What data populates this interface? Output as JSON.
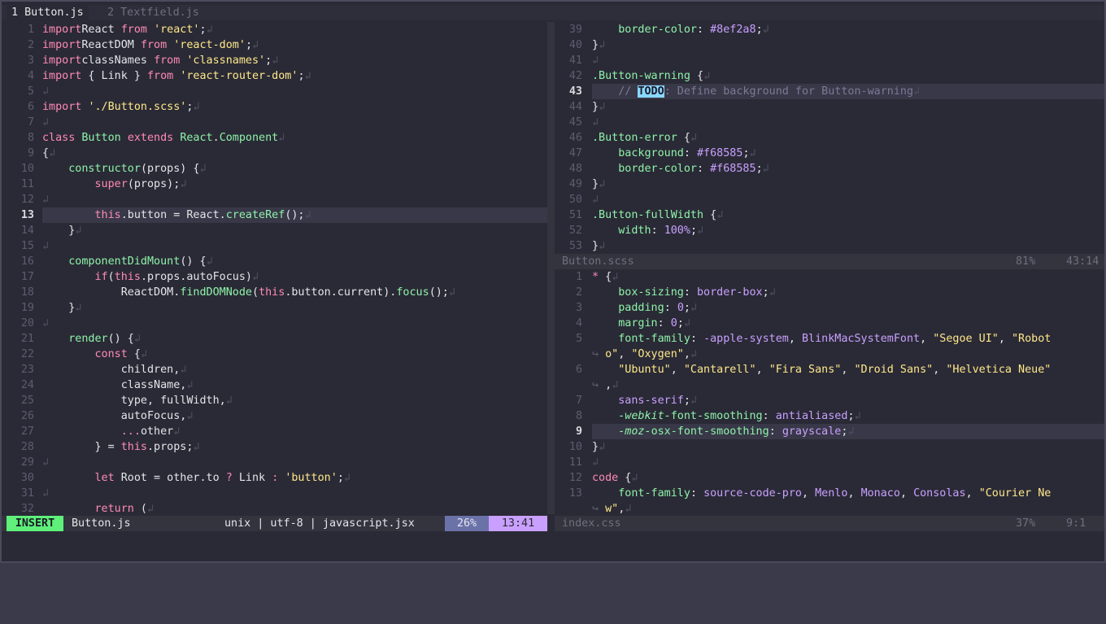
{
  "tabs": [
    {
      "number": "1",
      "label": "Button.js"
    },
    {
      "number": "2",
      "label": "Textfield.js"
    }
  ],
  "eol_glyph": "↲",
  "wrap_glyph": "↪",
  "left_pane": {
    "cursor_line": 13,
    "lines": [
      {
        "n": "1",
        "segs": [
          [
            "kw",
            "import"
          ],
          [
            "",
            "React "
          ],
          [
            "kw",
            "from"
          ],
          [
            "",
            " "
          ],
          [
            "st",
            "'react'"
          ],
          [
            "",
            ";"
          ]
        ]
      },
      {
        "n": "2",
        "segs": [
          [
            "kw",
            "import"
          ],
          [
            "",
            "ReactDOM "
          ],
          [
            "kw",
            "from"
          ],
          [
            "",
            " "
          ],
          [
            "st",
            "'react-dom'"
          ],
          [
            "",
            ";"
          ]
        ]
      },
      {
        "n": "3",
        "segs": [
          [
            "kw",
            "import"
          ],
          [
            "",
            "classNames "
          ],
          [
            "kw",
            "from"
          ],
          [
            "",
            " "
          ],
          [
            "st",
            "'classnames'"
          ],
          [
            "",
            ";"
          ]
        ]
      },
      {
        "n": "4",
        "segs": [
          [
            "kw",
            "import"
          ],
          [
            "",
            " { Link } "
          ],
          [
            "kw",
            "from"
          ],
          [
            "",
            " "
          ],
          [
            "st",
            "'react-router-dom'"
          ],
          [
            "",
            ";"
          ]
        ]
      },
      {
        "n": "5",
        "segs": []
      },
      {
        "n": "6",
        "segs": [
          [
            "kw",
            "import"
          ],
          [
            "",
            " "
          ],
          [
            "st",
            "'./Button.scss'"
          ],
          [
            "",
            ";"
          ]
        ]
      },
      {
        "n": "7",
        "segs": []
      },
      {
        "n": "8",
        "segs": [
          [
            "kw",
            "class"
          ],
          [
            "",
            " "
          ],
          [
            "cl",
            "Button"
          ],
          [
            "",
            " "
          ],
          [
            "kw",
            "extends"
          ],
          [
            "",
            " "
          ],
          [
            "cl",
            "React"
          ],
          [
            "",
            "."
          ],
          [
            "cl",
            "Component"
          ]
        ]
      },
      {
        "n": "9",
        "segs": [
          [
            "",
            "{"
          ]
        ]
      },
      {
        "n": "10",
        "segs": [
          [
            "",
            "    "
          ],
          [
            "fn",
            "constructor"
          ],
          [
            "",
            "(props) {"
          ]
        ]
      },
      {
        "n": "11",
        "segs": [
          [
            "",
            "        "
          ],
          [
            "th",
            "super"
          ],
          [
            "",
            "(props);"
          ]
        ]
      },
      {
        "n": "12",
        "segs": []
      },
      {
        "n": "13",
        "segs": [
          [
            "",
            "        "
          ],
          [
            "th",
            "this"
          ],
          [
            "",
            ".button = React."
          ],
          [
            "fn",
            "createRef"
          ],
          [
            "",
            "();"
          ]
        ]
      },
      {
        "n": "14",
        "segs": [
          [
            "",
            "    }"
          ]
        ]
      },
      {
        "n": "15",
        "segs": []
      },
      {
        "n": "16",
        "segs": [
          [
            "",
            "    "
          ],
          [
            "fn",
            "componentDidMount"
          ],
          [
            "",
            "() {"
          ]
        ]
      },
      {
        "n": "17",
        "segs": [
          [
            "",
            "        "
          ],
          [
            "kw",
            "if"
          ],
          [
            "",
            "("
          ],
          [
            "th",
            "this"
          ],
          [
            "",
            ".props.autoFocus)"
          ]
        ]
      },
      {
        "n": "18",
        "segs": [
          [
            "",
            "            ReactDOM."
          ],
          [
            "fn",
            "findDOMNode"
          ],
          [
            "",
            "("
          ],
          [
            "th",
            "this"
          ],
          [
            "",
            ".button.current)."
          ],
          [
            "fn",
            "focus"
          ],
          [
            "",
            "();"
          ]
        ]
      },
      {
        "n": "19",
        "segs": [
          [
            "",
            "    }"
          ]
        ]
      },
      {
        "n": "20",
        "segs": []
      },
      {
        "n": "21",
        "segs": [
          [
            "",
            "    "
          ],
          [
            "fn",
            "render"
          ],
          [
            "",
            "() {"
          ]
        ]
      },
      {
        "n": "22",
        "segs": [
          [
            "",
            "        "
          ],
          [
            "kw",
            "const"
          ],
          [
            "",
            " {"
          ]
        ]
      },
      {
        "n": "23",
        "segs": [
          [
            "",
            "            children,"
          ]
        ]
      },
      {
        "n": "24",
        "segs": [
          [
            "",
            "            className,"
          ]
        ]
      },
      {
        "n": "25",
        "segs": [
          [
            "",
            "            type, fullWidth,"
          ]
        ]
      },
      {
        "n": "26",
        "segs": [
          [
            "",
            "            autoFocus,"
          ]
        ]
      },
      {
        "n": "27",
        "segs": [
          [
            "",
            "            "
          ],
          [
            "kw",
            "..."
          ],
          [
            "",
            "other"
          ]
        ]
      },
      {
        "n": "28",
        "segs": [
          [
            "",
            "        } = "
          ],
          [
            "th",
            "this"
          ],
          [
            "",
            ".props;"
          ]
        ]
      },
      {
        "n": "29",
        "segs": []
      },
      {
        "n": "30",
        "segs": [
          [
            "",
            "        "
          ],
          [
            "kw",
            "let"
          ],
          [
            "",
            " Root = other.to "
          ],
          [
            "kw",
            "?"
          ],
          [
            "",
            " Link "
          ],
          [
            "kw",
            ":"
          ],
          [
            "",
            " "
          ],
          [
            "st",
            "'button'"
          ],
          [
            "",
            ";"
          ]
        ]
      },
      {
        "n": "31",
        "segs": []
      },
      {
        "n": "32",
        "segs": [
          [
            "",
            "        "
          ],
          [
            "kw",
            "return"
          ],
          [
            "",
            " ("
          ]
        ]
      }
    ]
  },
  "right_top_pane": {
    "cursor_line": 43,
    "lines": [
      {
        "n": "39",
        "segs": [
          [
            "",
            "    "
          ],
          [
            "pr",
            "border-color"
          ],
          [
            "",
            ": "
          ],
          [
            "val",
            "#8ef2a8"
          ],
          [
            "",
            ";"
          ]
        ]
      },
      {
        "n": "40",
        "segs": [
          [
            "",
            "}"
          ]
        ]
      },
      {
        "n": "41",
        "segs": []
      },
      {
        "n": "42",
        "segs": [
          [
            "sel",
            ".Button-warning"
          ],
          [
            "",
            " {"
          ]
        ]
      },
      {
        "n": "43",
        "segs": [
          [
            "",
            "    "
          ],
          [
            "cm",
            "// "
          ],
          [
            "todo",
            "TODO"
          ],
          [
            "cm",
            ": Define background for Button-warning"
          ]
        ]
      },
      {
        "n": "44",
        "segs": [
          [
            "",
            "}"
          ]
        ]
      },
      {
        "n": "45",
        "segs": []
      },
      {
        "n": "46",
        "segs": [
          [
            "sel",
            ".Button-error"
          ],
          [
            "",
            " {"
          ]
        ]
      },
      {
        "n": "47",
        "segs": [
          [
            "",
            "    "
          ],
          [
            "pr",
            "background"
          ],
          [
            "",
            ": "
          ],
          [
            "val",
            "#f68585"
          ],
          [
            "",
            ";"
          ]
        ]
      },
      {
        "n": "48",
        "segs": [
          [
            "",
            "    "
          ],
          [
            "pr",
            "border-color"
          ],
          [
            "",
            ": "
          ],
          [
            "val",
            "#f68585"
          ],
          [
            "",
            ";"
          ]
        ]
      },
      {
        "n": "49",
        "segs": [
          [
            "",
            "}"
          ]
        ]
      },
      {
        "n": "50",
        "segs": []
      },
      {
        "n": "51",
        "segs": [
          [
            "sel",
            ".Button-fullWidth"
          ],
          [
            "",
            " {"
          ]
        ]
      },
      {
        "n": "52",
        "segs": [
          [
            "",
            "    "
          ],
          [
            "pr",
            "width"
          ],
          [
            "",
            ": "
          ],
          [
            "val",
            "100%"
          ],
          [
            "",
            ";"
          ]
        ]
      },
      {
        "n": "53",
        "segs": [
          [
            "",
            "}"
          ]
        ]
      }
    ]
  },
  "right_bottom_pane": {
    "cursor_line": 9,
    "lines": [
      {
        "n": "1",
        "segs": [
          [
            "kw",
            "*"
          ],
          [
            "",
            " {"
          ]
        ]
      },
      {
        "n": "2",
        "segs": [
          [
            "",
            "    "
          ],
          [
            "pr",
            "box-sizing"
          ],
          [
            "",
            ": "
          ],
          [
            "val",
            "border-box"
          ],
          [
            "",
            ";"
          ]
        ]
      },
      {
        "n": "3",
        "segs": [
          [
            "",
            "    "
          ],
          [
            "pr",
            "padding"
          ],
          [
            "",
            ": "
          ],
          [
            "val",
            "0"
          ],
          [
            "",
            ";"
          ]
        ]
      },
      {
        "n": "4",
        "segs": [
          [
            "",
            "    "
          ],
          [
            "pr",
            "margin"
          ],
          [
            "",
            ": "
          ],
          [
            "val",
            "0"
          ],
          [
            "",
            ";"
          ]
        ]
      },
      {
        "n": "5",
        "segs": [
          [
            "",
            "    "
          ],
          [
            "pr",
            "font-family"
          ],
          [
            "",
            ": "
          ],
          [
            "val",
            "-apple-system"
          ],
          [
            "",
            ", "
          ],
          [
            "val",
            "BlinkMacSystemFont"
          ],
          [
            "",
            ", "
          ],
          [
            "st",
            "\"Segoe UI\""
          ],
          [
            "",
            ", "
          ],
          [
            "st",
            "\"Robot"
          ]
        ],
        "noeol": true
      },
      {
        "n": "",
        "wrap": true,
        "segs": [
          [
            "st",
            "o\""
          ],
          [
            "",
            ", "
          ],
          [
            "st",
            "\"Oxygen\""
          ],
          [
            "",
            ","
          ]
        ]
      },
      {
        "n": "6",
        "segs": [
          [
            "",
            "    "
          ],
          [
            "st",
            "\"Ubuntu\""
          ],
          [
            "",
            ", "
          ],
          [
            "st",
            "\"Cantarell\""
          ],
          [
            "",
            ", "
          ],
          [
            "st",
            "\"Fira Sans\""
          ],
          [
            "",
            ", "
          ],
          [
            "st",
            "\"Droid Sans\""
          ],
          [
            "",
            ", "
          ],
          [
            "st",
            "\"Helvetica Neue\""
          ]
        ],
        "noeol": true
      },
      {
        "n": "",
        "wrap": true,
        "segs": [
          [
            "",
            ","
          ]
        ]
      },
      {
        "n": "7",
        "segs": [
          [
            "",
            "    "
          ],
          [
            "val",
            "sans-serif"
          ],
          [
            "",
            ";"
          ]
        ]
      },
      {
        "n": "8",
        "segs": [
          [
            "",
            "    "
          ],
          [
            "vend",
            "-webkit-"
          ],
          [
            "pr",
            "font-smoothing"
          ],
          [
            "",
            ": "
          ],
          [
            "val",
            "antialiased"
          ],
          [
            "",
            ";"
          ]
        ]
      },
      {
        "n": "9",
        "segs": [
          [
            "",
            "    "
          ],
          [
            "vend",
            "-moz-"
          ],
          [
            "pr",
            "osx-font-smoothing"
          ],
          [
            "",
            ": "
          ],
          [
            "val",
            "grayscale"
          ],
          [
            "",
            ";"
          ]
        ]
      },
      {
        "n": "10",
        "segs": [
          [
            "",
            "}"
          ]
        ]
      },
      {
        "n": "11",
        "segs": []
      },
      {
        "n": "12",
        "segs": [
          [
            "kw",
            "code"
          ],
          [
            "",
            " {"
          ]
        ]
      },
      {
        "n": "13",
        "segs": [
          [
            "",
            "    "
          ],
          [
            "pr",
            "font-family"
          ],
          [
            "",
            ": "
          ],
          [
            "val",
            "source-code-pro"
          ],
          [
            "",
            ", "
          ],
          [
            "val",
            "Menlo"
          ],
          [
            "",
            ", "
          ],
          [
            "val",
            "Monaco"
          ],
          [
            "",
            ", "
          ],
          [
            "val",
            "Consolas"
          ],
          [
            "",
            ", "
          ],
          [
            "st",
            "\"Courier Ne"
          ]
        ],
        "noeol": true
      },
      {
        "n": "",
        "wrap": true,
        "segs": [
          [
            "st",
            "w\""
          ],
          [
            "",
            ","
          ]
        ]
      }
    ]
  },
  "status_left": {
    "mode": "INSERT",
    "file": "Button.js",
    "info": "unix | utf-8 | javascript.jsx",
    "percent": "26%",
    "position": "13:41"
  },
  "status_right_top": {
    "file": "Button.scss",
    "percent": "81%",
    "position": "43:14"
  },
  "status_right_bottom": {
    "file": "index.css",
    "percent": "37%",
    "position": "9:1"
  },
  "colors": {
    "background": "#2a2a36",
    "insert_mode": "#5ef07a",
    "keyword": "#ff8ab5",
    "string": "#ffe88a",
    "function": "#8ef2a8",
    "value": "#c9a0ff",
    "todo": "#8ad8ff"
  }
}
